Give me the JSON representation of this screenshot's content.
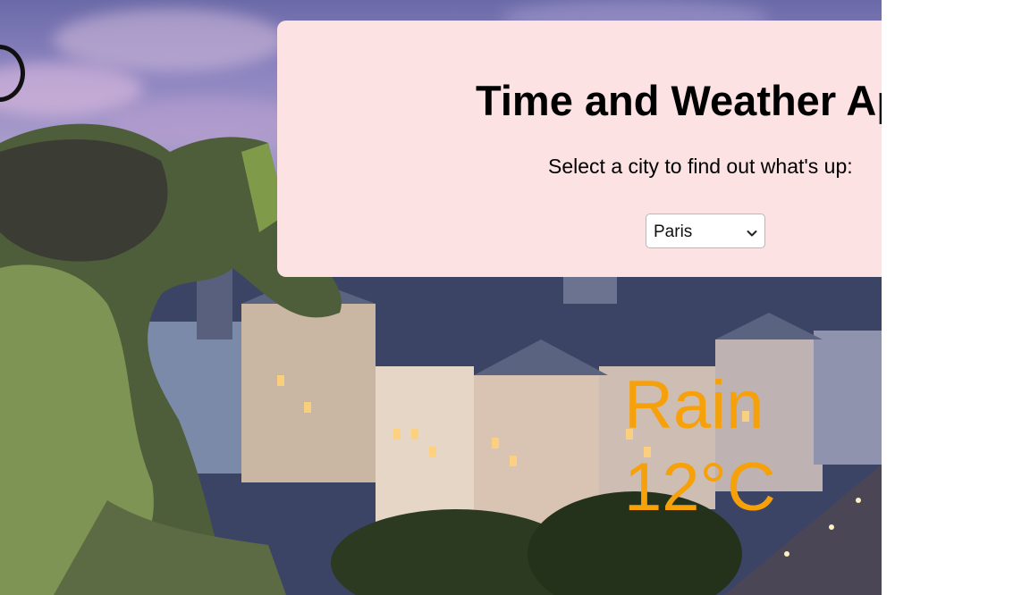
{
  "app": {
    "title": "Time and Weather App",
    "subtitle": "Select a city to find out what's up:"
  },
  "city_select": {
    "selected": "Paris"
  },
  "weather": {
    "condition": "Rain",
    "temperature": "12°C"
  },
  "colors": {
    "panel_bg": "#fde2e4",
    "weather_text": "#f6a10a"
  },
  "icons": {
    "dropdown": "chevron-down-icon"
  }
}
